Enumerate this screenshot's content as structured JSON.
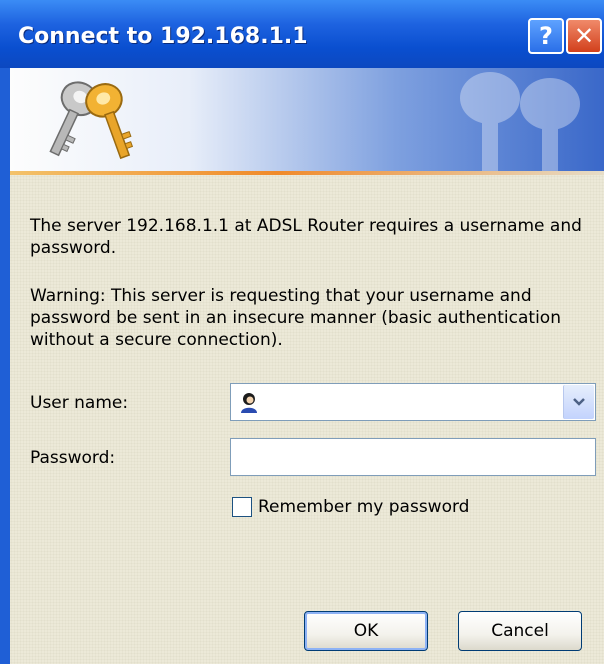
{
  "window": {
    "title": "Connect to 192.168.1.1",
    "help_label": "?",
    "close_label": "✕"
  },
  "message": {
    "line1": "The server 192.168.1.1 at ADSL Router requires a username and password.",
    "line2": "Warning: This server is requesting that your username and password be sent in an insecure manner (basic authentication without a secure connection)."
  },
  "form": {
    "username_label": "User name:",
    "username_value": "",
    "password_label": "Password:",
    "password_value": "",
    "remember_label": "Remember my password",
    "remember_checked": false
  },
  "buttons": {
    "ok": "OK",
    "cancel": "Cancel"
  },
  "icons": {
    "banner": "keys-icon",
    "user": "user-icon",
    "dropdown": "chevron-down-icon"
  },
  "colors": {
    "titlebar": "#0a4fd0",
    "body": "#ece9d8",
    "accent": "#f08a2a"
  }
}
